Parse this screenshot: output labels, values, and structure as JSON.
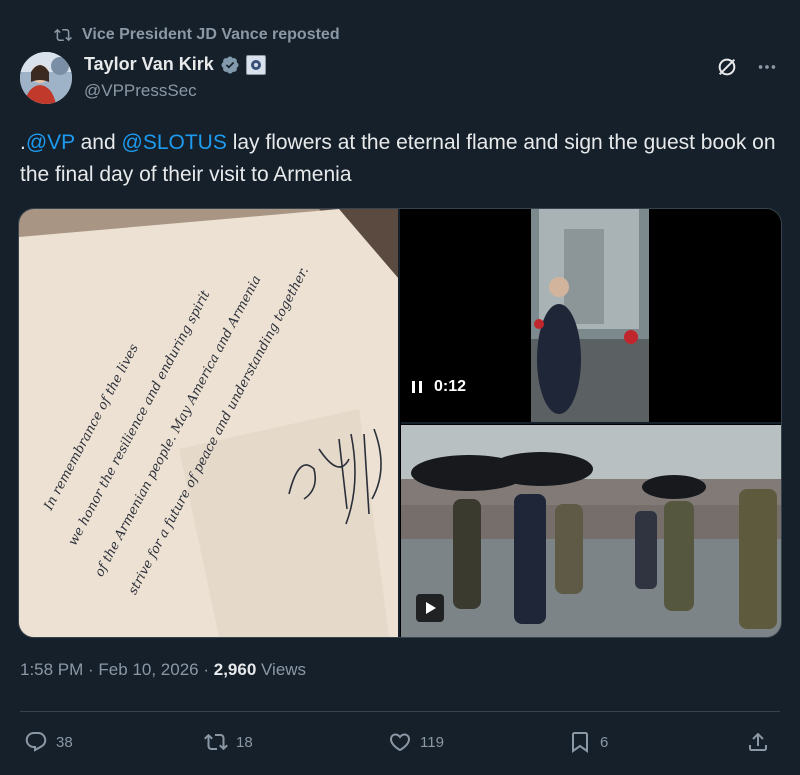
{
  "repost": {
    "label": "Vice President JD Vance reposted"
  },
  "author": {
    "name": "Taylor Van Kirk",
    "handle": "@VPPressSec"
  },
  "tweet": {
    "prefix": ".",
    "mention1": "@VP",
    "mid1": " and ",
    "mention2": "@SLOTUS",
    "rest": " lay flowers at the eternal flame and sign the guest book on the final day of their visit to Armenia"
  },
  "media": {
    "guestbook_lines": [
      "In remembrance of the lives",
      "we honor the resilience and enduring spirit",
      "of the Armenian people. May America and Armenia",
      "strive for a future of peace and understanding together."
    ],
    "video_time": "0:12"
  },
  "meta": {
    "time": "1:58 PM",
    "sep1": " · ",
    "date": "Feb 10, 2026",
    "sep2": " · ",
    "views_count": "2,960",
    "views_label": " Views"
  },
  "actions": {
    "replies": "38",
    "reposts": "18",
    "likes": "119",
    "bookmarks": "6"
  },
  "colors": {
    "background": "#15202b",
    "text": "#e7e9ea",
    "secondary": "#8b98a5",
    "accent": "#1d9bf0",
    "divider": "#38444d"
  }
}
